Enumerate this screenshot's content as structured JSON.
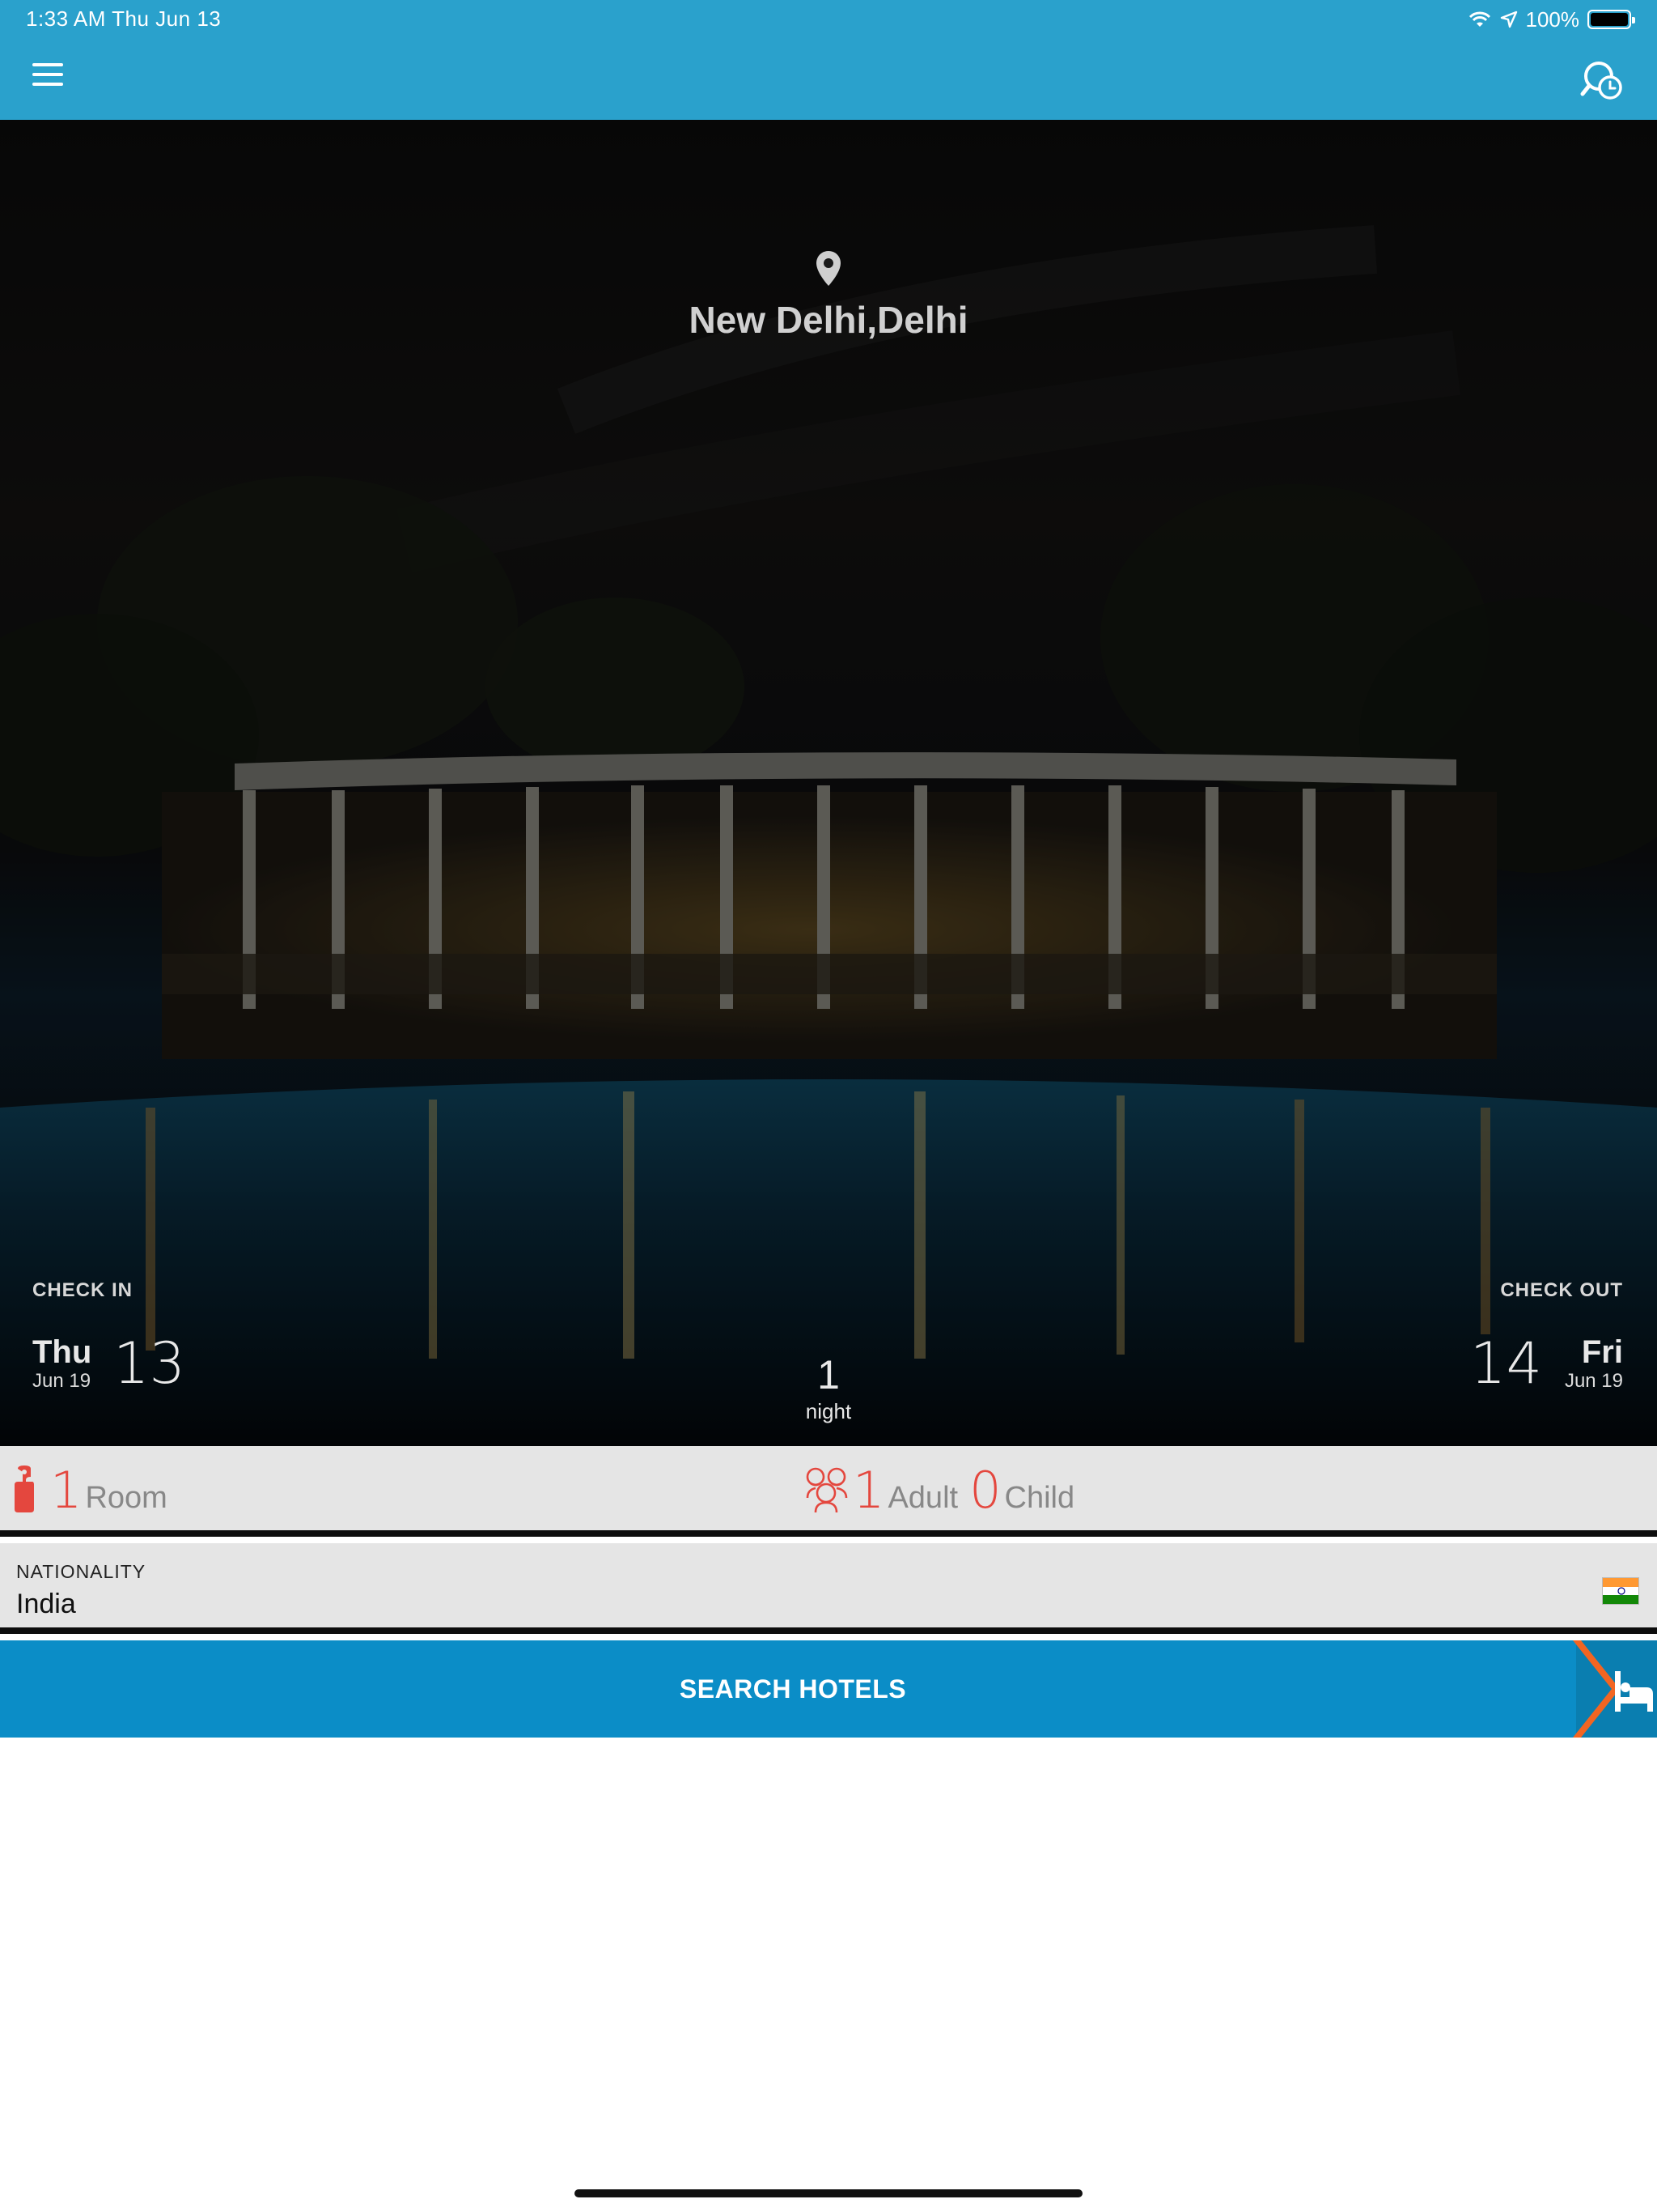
{
  "status_bar": {
    "time_date": "1:33 AM   Thu Jun 13",
    "battery": "100%",
    "battery_level": 1.0
  },
  "header": {
    "menu_icon": "hamburger-menu-icon",
    "history_icon": "search-history-icon"
  },
  "hero": {
    "location_icon": "location-pin-icon",
    "city": "New Delhi,Delhi",
    "check_in": {
      "label": "CHECK IN",
      "weekday": "Thu",
      "month_year": "Jun 19",
      "day": "13"
    },
    "check_out": {
      "label": "CHECK OUT",
      "weekday": "Fri",
      "month_year": "Jun 19",
      "day": "14"
    },
    "nights": {
      "count": "1",
      "label": "night"
    }
  },
  "guests": {
    "room_icon": "door-hanger-icon",
    "rooms": "1",
    "rooms_label": "Room",
    "guests_icon": "people-group-icon",
    "adults": "1",
    "adults_label": "Adult",
    "children": "0",
    "children_label": "Child"
  },
  "nationality": {
    "label": "NATIONALITY",
    "value": "India",
    "flag_icon": "india-flag-icon"
  },
  "search": {
    "label": "SEARCH HOTELS",
    "icon": "hotel-bed-icon"
  },
  "colors": {
    "header_bg": "#2aa1cc",
    "search_bg": "#0b8dc7",
    "accent_red": "#e4473e",
    "arrow_orange": "#f26522"
  }
}
